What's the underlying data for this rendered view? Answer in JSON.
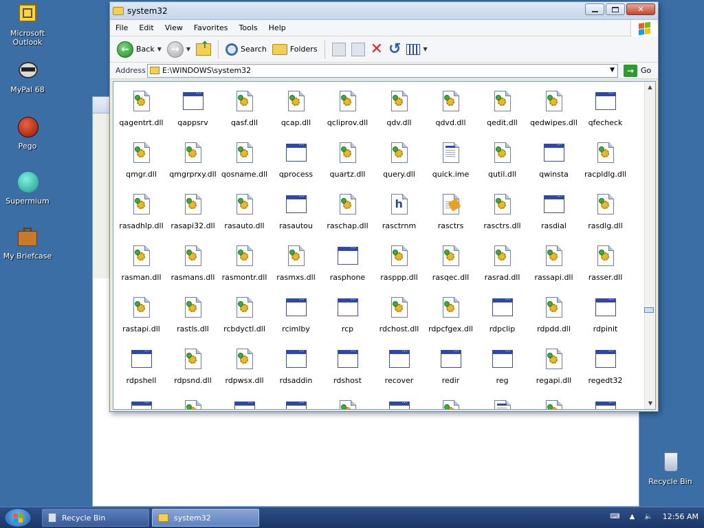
{
  "desktop": {
    "icons": [
      {
        "label": "Microsoft Outlook",
        "icon": "outlook-icon"
      },
      {
        "label": "MyPal 68",
        "icon": "mypal-icon"
      },
      {
        "label": "Pego",
        "icon": "pego-icon"
      },
      {
        "label": "Supermium",
        "icon": "supermium-icon"
      },
      {
        "label": "My Briefcase",
        "icon": "briefcase-icon"
      },
      {
        "label": "Recycle Bin",
        "icon": "recycle-bin-icon"
      }
    ]
  },
  "window": {
    "title": "system32",
    "menu": [
      "File",
      "Edit",
      "View",
      "Favorites",
      "Tools",
      "Help"
    ],
    "toolbar": {
      "back": "Back",
      "search": "Search",
      "folders": "Folders"
    },
    "address": {
      "label": "Address",
      "path": "E:\\WINDOWS\\system32",
      "go": "Go"
    }
  },
  "files": [
    {
      "name": "qagentrt.dll",
      "type": "dll"
    },
    {
      "name": "qappsrv",
      "type": "exe"
    },
    {
      "name": "qasf.dll",
      "type": "dll"
    },
    {
      "name": "qcap.dll",
      "type": "dll"
    },
    {
      "name": "qcliprov.dll",
      "type": "dll"
    },
    {
      "name": "qdv.dll",
      "type": "dll"
    },
    {
      "name": "qdvd.dll",
      "type": "dll"
    },
    {
      "name": "qedit.dll",
      "type": "dll"
    },
    {
      "name": "qedwipes.dll",
      "type": "dll"
    },
    {
      "name": "qfecheck",
      "type": "exe"
    },
    {
      "name": "qmgr.dll",
      "type": "dll"
    },
    {
      "name": "qmgrprxy.dll",
      "type": "dll"
    },
    {
      "name": "qosname.dll",
      "type": "dll"
    },
    {
      "name": "qprocess",
      "type": "exe"
    },
    {
      "name": "quartz.dll",
      "type": "dll"
    },
    {
      "name": "query.dll",
      "type": "dll"
    },
    {
      "name": "quick.ime",
      "type": "ime"
    },
    {
      "name": "qutil.dll",
      "type": "dll"
    },
    {
      "name": "qwinsta",
      "type": "exe"
    },
    {
      "name": "racpldlg.dll",
      "type": "dll"
    },
    {
      "name": "rasadhlp.dll",
      "type": "dll"
    },
    {
      "name": "rasapi32.dll",
      "type": "dll"
    },
    {
      "name": "rasauto.dll",
      "type": "dll"
    },
    {
      "name": "rasautou",
      "type": "exe"
    },
    {
      "name": "raschap.dll",
      "type": "dll"
    },
    {
      "name": "rasctrnm",
      "type": "h"
    },
    {
      "name": "rasctrs",
      "type": "ini"
    },
    {
      "name": "rasctrs.dll",
      "type": "dll"
    },
    {
      "name": "rasdial",
      "type": "exe"
    },
    {
      "name": "rasdlg.dll",
      "type": "dll"
    },
    {
      "name": "rasman.dll",
      "type": "dll"
    },
    {
      "name": "rasmans.dll",
      "type": "dll"
    },
    {
      "name": "rasmontr.dll",
      "type": "dll"
    },
    {
      "name": "rasmxs.dll",
      "type": "dll"
    },
    {
      "name": "rasphone",
      "type": "exe"
    },
    {
      "name": "rasppp.dll",
      "type": "dll"
    },
    {
      "name": "rasqec.dll",
      "type": "dll"
    },
    {
      "name": "rasrad.dll",
      "type": "dll"
    },
    {
      "name": "rassapi.dll",
      "type": "dll"
    },
    {
      "name": "rasser.dll",
      "type": "dll"
    },
    {
      "name": "rastapi.dll",
      "type": "dll"
    },
    {
      "name": "rastls.dll",
      "type": "dll"
    },
    {
      "name": "rcbdyctl.dll",
      "type": "dll"
    },
    {
      "name": "rcimlby",
      "type": "exe"
    },
    {
      "name": "rcp",
      "type": "exe"
    },
    {
      "name": "rdchost.dll",
      "type": "dll"
    },
    {
      "name": "rdpcfgex.dll",
      "type": "dll"
    },
    {
      "name": "rdpclip",
      "type": "exe"
    },
    {
      "name": "rdpdd.dll",
      "type": "dll"
    },
    {
      "name": "rdpinit",
      "type": "exe"
    },
    {
      "name": "rdpshell",
      "type": "exe"
    },
    {
      "name": "rdpsnd.dll",
      "type": "dll"
    },
    {
      "name": "rdpwsx.dll",
      "type": "dll"
    },
    {
      "name": "rdsaddin",
      "type": "exe"
    },
    {
      "name": "rdshost",
      "type": "exe"
    },
    {
      "name": "recover",
      "type": "exe"
    },
    {
      "name": "redir",
      "type": "exe"
    },
    {
      "name": "reg",
      "type": "exe"
    },
    {
      "name": "regapi.dll",
      "type": "dll"
    },
    {
      "name": "regedt32",
      "type": "exe"
    },
    {
      "name": "",
      "type": "exe"
    },
    {
      "name": "",
      "type": "dll"
    },
    {
      "name": "",
      "type": "exe"
    },
    {
      "name": "",
      "type": "exe"
    },
    {
      "name": "",
      "type": "dll"
    },
    {
      "name": "",
      "type": "exe"
    },
    {
      "name": "",
      "type": "dll"
    },
    {
      "name": "",
      "type": "ime"
    },
    {
      "name": "",
      "type": "dll"
    },
    {
      "name": "",
      "type": "exe"
    }
  ],
  "taskbar": {
    "tasks": [
      "Recycle Bin",
      "system32"
    ],
    "clock": "12:56 AM"
  },
  "colors": {
    "desktop": "#3a6ea5",
    "taskbar": "#1b3566"
  }
}
